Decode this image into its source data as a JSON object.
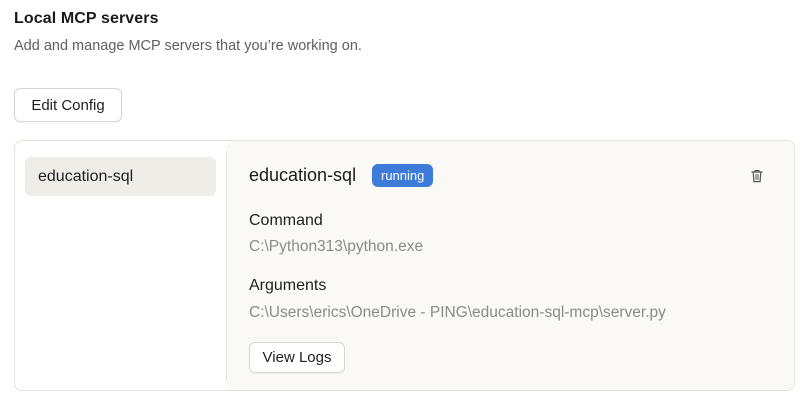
{
  "header": {
    "title": "Local MCP servers",
    "subtitle": "Add and manage MCP servers that you’re working on."
  },
  "toolbar": {
    "edit_config_label": "Edit Config"
  },
  "sidebar": {
    "items": [
      {
        "label": "education-sql",
        "selected": true
      }
    ]
  },
  "detail": {
    "name": "education-sql",
    "status": "running",
    "status_color": "#3d7bd9",
    "delete_icon": "trash-icon",
    "command_label": "Command",
    "command_value": "C:\\Python313\\python.exe",
    "arguments_label": "Arguments",
    "arguments_value": "C:\\Users\\erics\\OneDrive - PING\\education-sql-mcp\\server.py",
    "view_logs_label": "View Logs"
  }
}
